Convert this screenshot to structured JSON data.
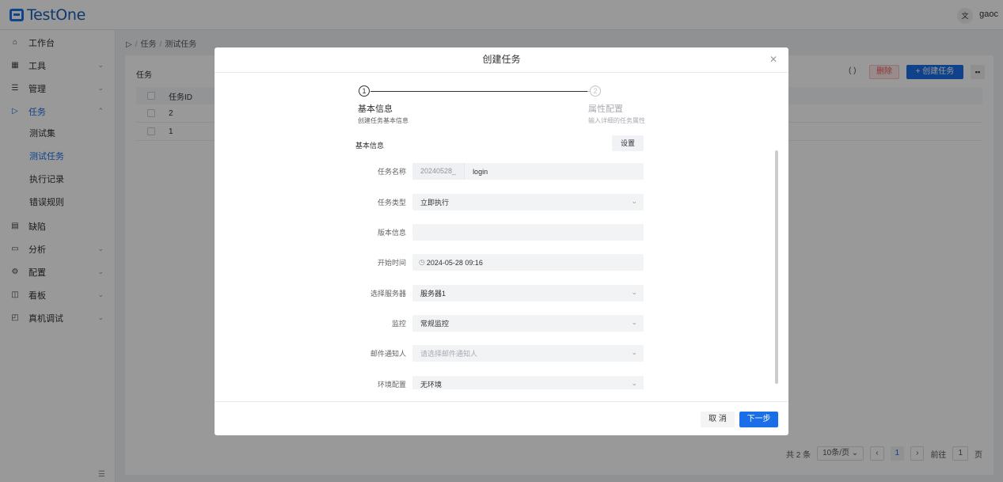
{
  "app": {
    "logo": "TestOne",
    "lang": "文",
    "user": "gaoc"
  },
  "sidebar": {
    "items": [
      {
        "label": "工作台",
        "icon": "home-icon"
      },
      {
        "label": "工具",
        "icon": "grid-icon"
      },
      {
        "label": "管理",
        "icon": "list-icon"
      },
      {
        "label": "任务",
        "icon": "play-icon"
      },
      {
        "label": "缺陷",
        "icon": "doc-icon"
      },
      {
        "label": "分析",
        "icon": "chart-icon"
      },
      {
        "label": "配置",
        "icon": "gear-icon"
      },
      {
        "label": "看板",
        "icon": "board-icon"
      },
      {
        "label": "真机调试",
        "icon": "device-icon"
      }
    ],
    "sub_items": [
      "测试集",
      "测试任务",
      "执行记录",
      "错误规则"
    ],
    "active_sub": "测试任务"
  },
  "breadcrumb": {
    "items": [
      "任务",
      "测试任务"
    ]
  },
  "card": {
    "title": "任务",
    "delete_label": "删除",
    "create_label": "+ 创建任务",
    "table": {
      "header": "任务ID",
      "rows": [
        "2",
        "1"
      ]
    },
    "pager": {
      "total": "共 2 条",
      "page_size": "10条/页",
      "current": "1",
      "goto_prefix": "前往",
      "goto_value": "1",
      "goto_suffix": "页"
    }
  },
  "dialog": {
    "title": "创建任务",
    "steps": [
      {
        "num": "1",
        "title": "基本信息",
        "desc": "创建任务基本信息"
      },
      {
        "num": "2",
        "title": "属性配置",
        "desc": "输入详细的任务属性"
      }
    ],
    "section_label": "基本信息",
    "settings_label": "设置",
    "fields": {
      "name_label": "任务名称",
      "name_prefix": "20240528_",
      "name_value": "login",
      "type_label": "任务类型",
      "type_value": "立即执行",
      "version_label": "版本信息",
      "version_value": "",
      "start_label": "开始时间",
      "start_value": "2024-05-28 09:16",
      "server_label": "选择服务器",
      "server_value": "服务器1",
      "monitor_label": "监控",
      "monitor_value": "常规监控",
      "mail_label": "邮件通知人",
      "mail_placeholder": "请选择邮件通知人",
      "env_label": "环境配置",
      "env_value": "无环境"
    },
    "cancel_label": "取 消",
    "next_label": "下一步"
  }
}
